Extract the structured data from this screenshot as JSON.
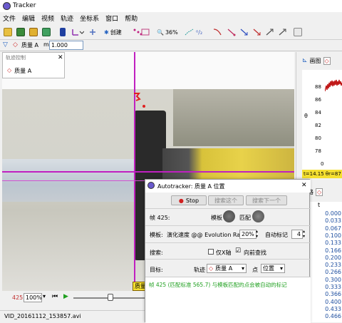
{
  "app": {
    "title": "Tracker"
  },
  "menu": [
    "文件",
    "编辑",
    "视频",
    "轨迹",
    "坐标系",
    "窗口",
    "帮助"
  ],
  "toolbar": {
    "create_label": "创建",
    "zoom_label": "36%"
  },
  "toolbar2": {
    "track_name": "质量 A",
    "m_label": "m",
    "m_value": "1.000"
  },
  "track_control": {
    "title": "轨迹控制",
    "item": "质量 A"
  },
  "playbar": {
    "frame": "425",
    "zoom": "100%"
  },
  "status": {
    "filename": "VID_20161112_153857.avi"
  },
  "video_overlay_tag": "质量",
  "right_panel": {
    "tab_plot": "画图",
    "tab_table": "表格",
    "plot_ylabel": "θ",
    "plot_ticks": [
      "88",
      "86",
      "84",
      "82",
      "80",
      "78",
      "76",
      "0"
    ],
    "tooltip": "t=14.15  θr=87",
    "table_col": "t",
    "table_values": [
      "0.000",
      "0.033",
      "0.067",
      "0.100",
      "0.133",
      "0.166",
      "0.200",
      "0.233",
      "0.266",
      "0.300",
      "0.333",
      "0.366",
      "0.400",
      "0.433",
      "0.466"
    ]
  },
  "dialog": {
    "title": "Autotracker: 质量 A 位置",
    "stop": "Stop",
    "search_this": "搜索这个",
    "search_next": "搜索下一个",
    "frame_label": "帧 425:",
    "template_label": "模板",
    "match_label": "匹配",
    "template_row_label": "模板:",
    "evolution_label": "演化速度 @@ Evolution Rate",
    "evolution_value": "20%",
    "auto_mark_label": "自动标记",
    "auto_mark_value": "4",
    "search_label": "搜索:",
    "x_axis_only": "仅X轴",
    "look_ahead": "向前查找",
    "target_label": "目标:",
    "track_label": "轨迹",
    "track_value": "质量 A",
    "point_label": "点",
    "point_value": "位置",
    "message": "帧 425 (匹配标准 565.7) 与模板匹配的点会被自动的标记"
  },
  "colors": {
    "accent": "#c020c0",
    "message": "#20a020",
    "stop_dot": "#d02020"
  }
}
